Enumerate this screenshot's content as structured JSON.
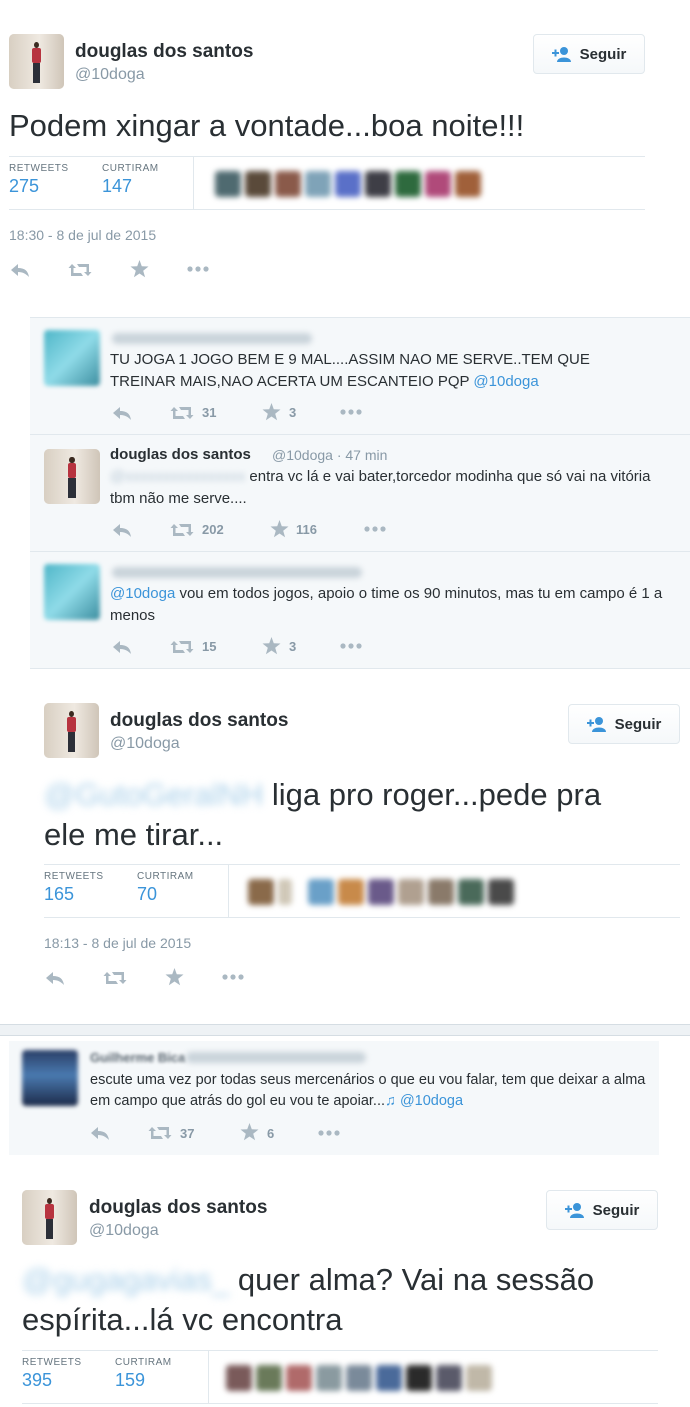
{
  "tweet1": {
    "name": "douglas dos santos",
    "handle": "@10doga",
    "follow_label": "Seguir",
    "text": "Podem xingar a vontade...boa noite!!!",
    "retweets_label": "RETWEETS",
    "retweets": "275",
    "likes_label": "CURTIRAM",
    "likes": "147",
    "date": "18:30 - 8 de jul de 2015"
  },
  "replies1": [
    {
      "text": "TU JOGA 1 JOGO BEM E 9 MAL....ASSIM NAO ME SERVE..TEM QUE TREINAR MAIS,NAO ACERTA UM ESCANTEIO PQP",
      "mention": "@10doga",
      "retweets": "31",
      "likes": "3"
    },
    {
      "name": "douglas dos santos",
      "meta": "@10doga · 47 min",
      "text": "entra vc lá e vai bater,torcedor modinha  que só vai na vitória tbm não me serve....",
      "retweets": "202",
      "likes": "116"
    },
    {
      "mention": "@10doga",
      "text": "vou em todos jogos, apoio o time os 90 minutos, mas tu em campo é 1 a menos",
      "retweets": "15",
      "likes": "3"
    }
  ],
  "tweet2": {
    "name": "douglas dos santos",
    "handle": "@10doga",
    "follow_label": "Seguir",
    "text_line1": "liga pro roger...pede pra",
    "text_line2": "ele me tirar...",
    "retweets_label": "RETWEETS",
    "retweets": "165",
    "likes_label": "CURTIRAM",
    "likes": "70",
    "date": "18:13 - 8 de jul de 2015"
  },
  "reply2": {
    "name": "Guilherme Bica",
    "text": "escute uma vez por todas seus mercenários o que eu vou falar, tem que deixar a alma em campo que atrás do gol eu vou te apoiar...",
    "mention": "@10doga",
    "retweets": "37",
    "likes": "6"
  },
  "tweet3": {
    "name": "douglas dos santos",
    "handle": "@10doga",
    "follow_label": "Seguir",
    "text_line1": "quer alma? Vai na sessão",
    "text_line2": "espírita...lá vc encontra",
    "retweets_label": "RETWEETS",
    "retweets": "395",
    "likes_label": "CURTIRAM",
    "likes": "159"
  },
  "colors": {
    "link": "#3b94d9",
    "muted": "#8899a6",
    "panel": "#f5f8fa",
    "text": "#292f33"
  },
  "icons": [
    "reply-icon",
    "retweet-icon",
    "favorite-icon",
    "more-icon",
    "follow-icon",
    "music-note-icon"
  ]
}
